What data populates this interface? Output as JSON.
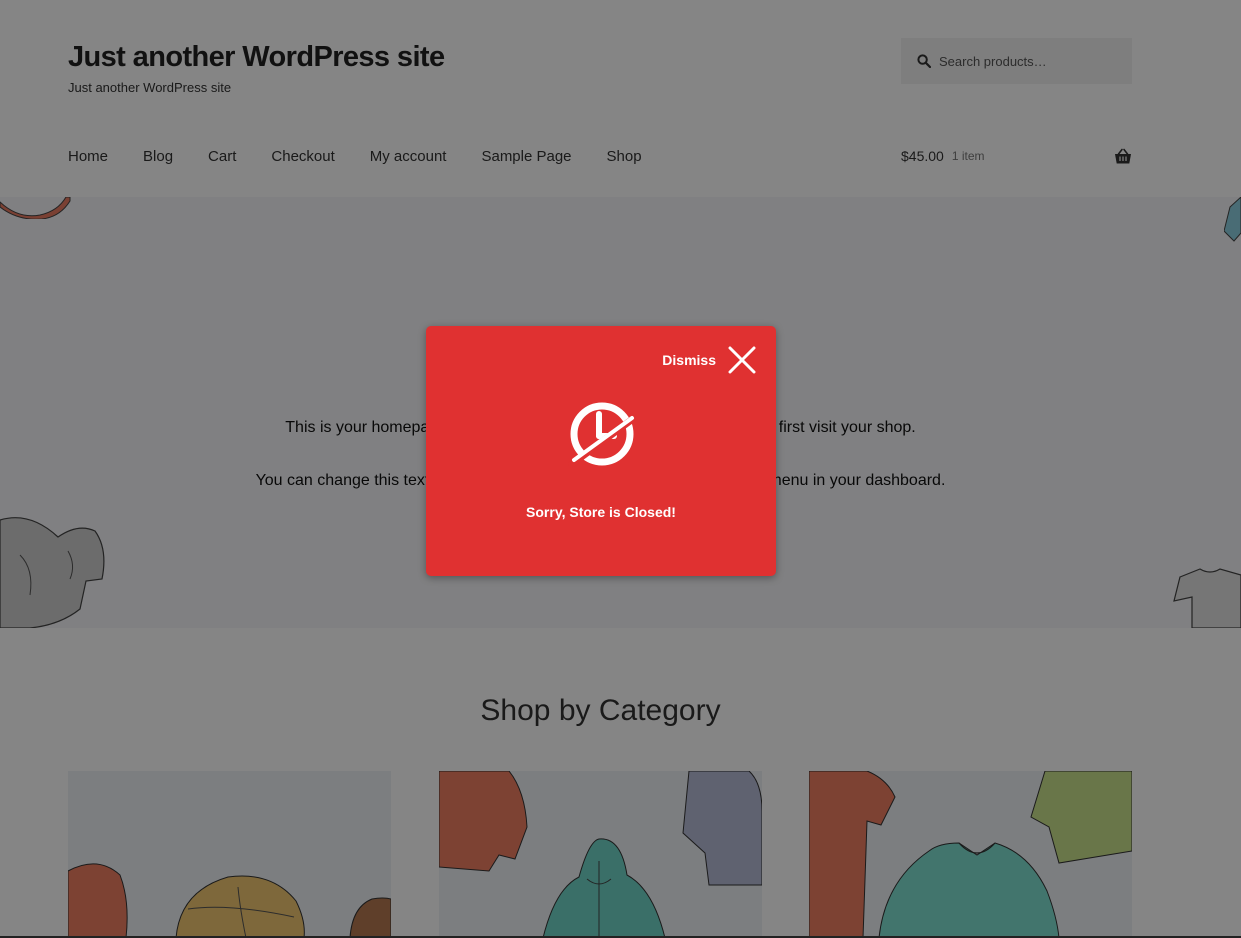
{
  "header": {
    "site_title": "Just another WordPress site",
    "site_description": "Just another WordPress site",
    "search_placeholder": "Search products…"
  },
  "nav": {
    "items": [
      "Home",
      "Blog",
      "Cart",
      "Checkout",
      "My account",
      "Sample Page",
      "Shop"
    ]
  },
  "cart": {
    "amount": "$45.00",
    "count": "1 item"
  },
  "hero": {
    "line1": "This is your homepage which is what most visitors will see when they first visit your shop.",
    "line2": "You can change this text by editing the \"Welcome\" page via the \"Pages\" menu in your dashboard."
  },
  "categories": {
    "title": "Shop by Category"
  },
  "modal": {
    "dismiss_label": "Dismiss",
    "message": "Sorry, Store is Closed!"
  },
  "colors": {
    "modal_bg": "#e03131",
    "overlay": "rgba(0,0,0,0.48)"
  }
}
